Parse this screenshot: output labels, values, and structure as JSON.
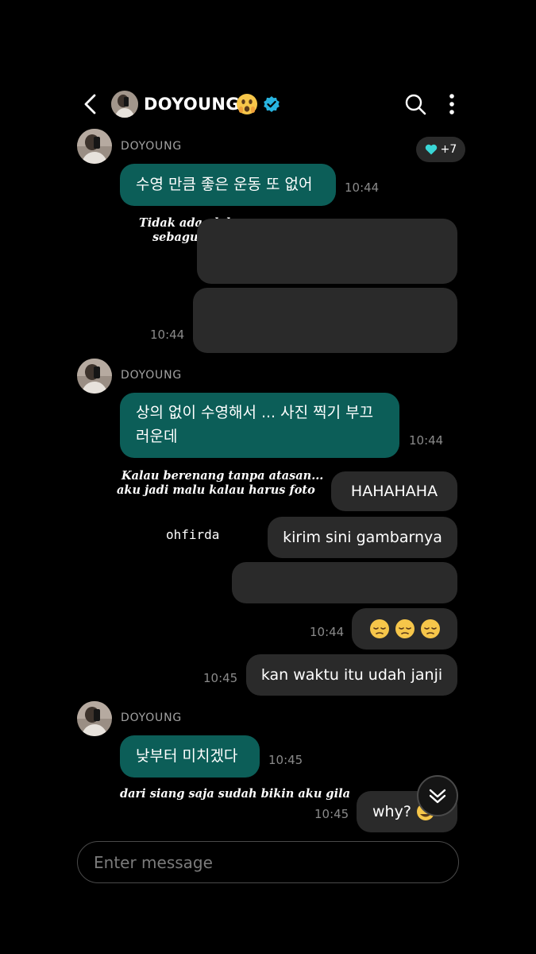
{
  "header": {
    "name": "DOYOUNG"
  },
  "reaction": {
    "count": "+7"
  },
  "messages": {
    "m1": {
      "sender": "DOYOUNG",
      "text": "수영 만큼 좋은 운동 또 없어",
      "time": "10:44"
    },
    "m1_caption": [
      "Tidak ada olahraga yang",
      "sebagus berenang"
    ],
    "o1": {
      "time": "10:44"
    },
    "m2": {
      "sender": "DOYOUNG",
      "line1": "상의 없이 수영해서 ... 사진 찍기 부끄",
      "line2": "러운데",
      "time": "10:44"
    },
    "m2_caption": [
      "Kalau berenang tanpa atasan...",
      "aku jadi malu kalau harus foto"
    ],
    "o2": {
      "text": "HAHAHAHA"
    },
    "o3": {
      "text": "kirim sini gambarnya"
    },
    "o3_caption": "ohfirda",
    "o5": {
      "time": "10:44"
    },
    "o6": {
      "text": "kan waktu itu udah janji",
      "time": "10:45"
    },
    "m3": {
      "sender": "DOYOUNG",
      "text": "낮부터 미치겠다",
      "time": "10:45"
    },
    "m3_caption": "dari siang saja sudah bikin aku gila",
    "o7": {
      "text": "why?",
      "time": "10:45"
    }
  },
  "composer": {
    "placeholder": "Enter message"
  },
  "colors": {
    "incoming_bubble": "#0c5e58",
    "outgoing_bubble": "#2a2a2a",
    "verified": "#28b4e0",
    "heart": "#3ad6d6"
  }
}
